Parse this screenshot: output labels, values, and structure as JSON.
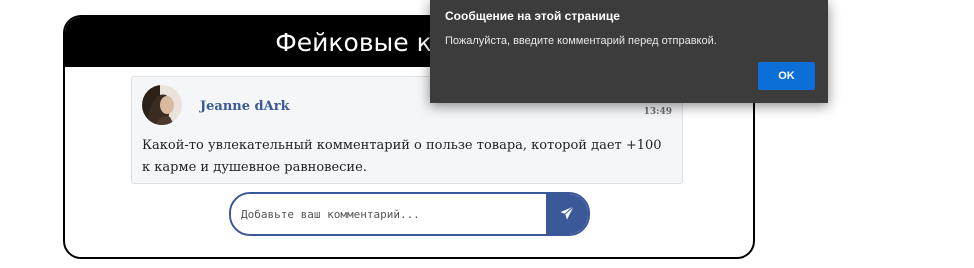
{
  "page": {
    "title": "Фейковые комментарии"
  },
  "comment": {
    "author": "Jeanne dArk",
    "time": "13:49",
    "text": "Какой-то увлекательный комментарий о пользе товара, которой дает +100 к карме и душевное равновесие.",
    "avatar_icon": "person-avatar"
  },
  "composer": {
    "placeholder": "Добавьте ваш комментарий...",
    "value": "",
    "send_icon": "paper-plane-icon",
    "accent": "#3b5998"
  },
  "alert": {
    "title": "Сообщение на этой странице",
    "message": "Пожалуйста, введите комментарий перед отправкой.",
    "ok_label": "OK",
    "background": "#3c3c3c",
    "button_color": "#0c6fd8"
  }
}
